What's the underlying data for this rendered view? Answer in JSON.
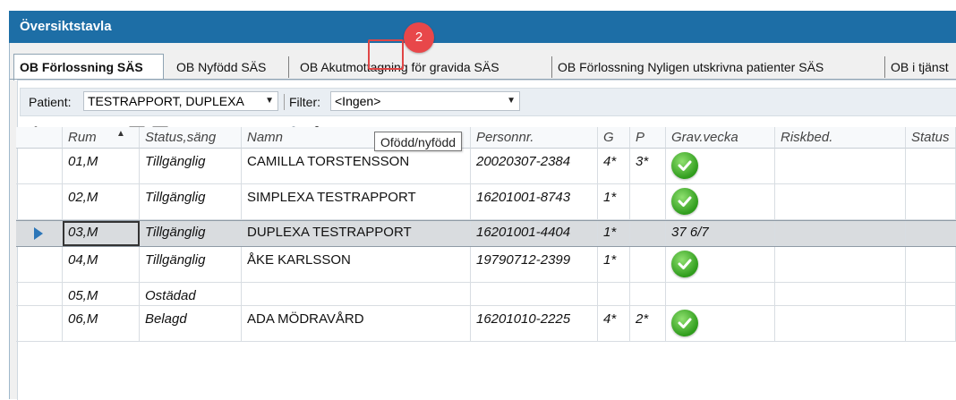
{
  "window": {
    "title": "Översiktstavla"
  },
  "tabs": [
    {
      "label": "OB Förlossning SÄS",
      "active": true
    },
    {
      "label": "OB Nyfödd SÄS",
      "active": false
    },
    {
      "label": "OB Akutmottagning för gravida SÄS",
      "active": false
    },
    {
      "label": "OB Förlossning Nyligen utskrivna patienter SÄS",
      "active": false
    },
    {
      "label": "OB i tjänst",
      "active": false
    }
  ],
  "filters": {
    "patient_label": "Patient:",
    "patient_value": "TESTRAPPORT, DUPLEXA",
    "filter_label": "Filter:",
    "filter_value": "<Ingen>"
  },
  "toolbar": {
    "icons": [
      "person-icon",
      "folder-red-icon",
      "edit-icon",
      "add-icon",
      "check-list-icon",
      "check-list-red-icon",
      "open-folder-icon",
      "settings-icon",
      "user-icon",
      "user-red-icon",
      "bag-icon",
      "newborn-icon"
    ],
    "highlighted_tool": "newborn-icon",
    "step_badge": "2",
    "tooltip": "Ofödd/nyfödd"
  },
  "grid": {
    "columns": [
      "Rum",
      "Status,säng",
      "Namn",
      "Personnr.",
      "G",
      "P",
      "Grav.vecka",
      "Riskbed.",
      "Status"
    ],
    "rows": [
      {
        "rum": "01,M",
        "status": "Tillgänglig",
        "namn": "CAMILLA TORSTENSSON",
        "personnr": "20020307-2384",
        "g": "4*",
        "p": "3*",
        "grav": "check",
        "selected": false
      },
      {
        "rum": "02,M",
        "status": "Tillgänglig",
        "namn": "SIMPLEXA TESTRAPPORT",
        "personnr": "16201001-8743",
        "g": "1*",
        "p": "",
        "grav": "check",
        "selected": false
      },
      {
        "rum": "03,M",
        "status": "Tillgänglig",
        "namn": "DUPLEXA TESTRAPPORT",
        "personnr": "16201001-4404",
        "g": "1*",
        "p": "",
        "grav": "37 6/7",
        "selected": true
      },
      {
        "rum": "04,M",
        "status": "Tillgänglig",
        "namn": "ÅKE KARLSSON",
        "personnr": "19790712-2399",
        "g": "1*",
        "p": "",
        "grav": "check",
        "selected": false
      },
      {
        "rum": "05,M",
        "status": "Ostädad",
        "namn": "",
        "personnr": "",
        "g": "",
        "p": "",
        "grav": "",
        "selected": false
      },
      {
        "rum": "06,M",
        "status": "Belagd",
        "namn": "ADA MÖDRAVÅRD",
        "personnr": "16201010-2225",
        "g": "4*",
        "p": "2*",
        "grav": "check",
        "selected": false
      }
    ]
  },
  "colors": {
    "titlebar": "#1d6ea6",
    "badge": "#e8474a",
    "highlight": "#e04646",
    "check": "#2f9c1c"
  }
}
